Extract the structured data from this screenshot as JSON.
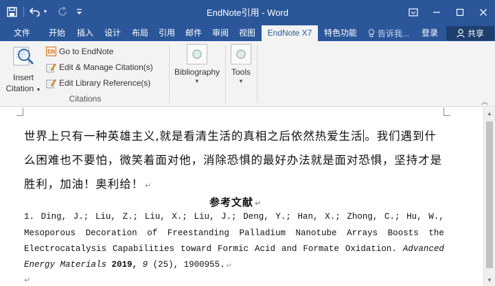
{
  "app": {
    "title": "EndNote引用 - Word"
  },
  "tabs": [
    {
      "label": "文件",
      "active": false
    },
    {
      "label": "开始",
      "active": false
    },
    {
      "label": "插入",
      "active": false
    },
    {
      "label": "设计",
      "active": false
    },
    {
      "label": "布局",
      "active": false
    },
    {
      "label": "引用",
      "active": false
    },
    {
      "label": "邮件",
      "active": false
    },
    {
      "label": "审阅",
      "active": false
    },
    {
      "label": "视图",
      "active": false
    },
    {
      "label": "EndNote X7",
      "active": true
    },
    {
      "label": "特色功能",
      "active": false
    }
  ],
  "tell_me": "告诉我...",
  "login": "登录",
  "share": "共享",
  "ribbon": {
    "insert_citation": {
      "line1": "Insert",
      "line2": "Citation"
    },
    "commands": [
      {
        "label": "Go to EndNote",
        "icon": "endnote-icon"
      },
      {
        "label": "Edit & Manage Citation(s)",
        "icon": "edit-citation-icon"
      },
      {
        "label": "Edit Library Reference(s)",
        "icon": "edit-reference-icon"
      }
    ],
    "group_label": "Citations",
    "bibliography": "Bibliography",
    "tools": "Tools"
  },
  "document": {
    "para": {
      "line1_a": "世界上只有一种英雄主义,就是看清生活的真相之后依然热爱生活",
      "line1_b": "。我们遇到什",
      "line2": "么困难也不要怕，微笑着面对他，消除恐惧的最好办法就是面对恐惧，坚持才是",
      "line3": "胜利，加油！奥利给！"
    },
    "heading": "参考文献",
    "reference": {
      "line1": [
        "1.",
        "Ding,",
        "J.;",
        "Liu,",
        "Z.;",
        "Liu,",
        "X.;",
        "Liu,",
        "J.;",
        "Deng,",
        "Y.;",
        "Han,",
        "X.;",
        "Zhong,",
        "C.;",
        "Hu,",
        "W.,"
      ],
      "line2": [
        "Mesoporous",
        "Decoration",
        "of",
        "Freestanding",
        "Palladium",
        "Nanotube",
        "Arrays",
        "Boosts",
        "the"
      ],
      "line3": [
        "Electrocatalysis",
        "Capabilities",
        "toward",
        "Formic",
        "Acid",
        "and",
        "Formate",
        "Oxidation.",
        "Advanced"
      ],
      "line4_journal": "Energy Materials",
      "line4_year": "2019,",
      "line4_volume": "9",
      "line4_rest": "(25), 1900955."
    },
    "paragraph_mark": "↵"
  },
  "colors": {
    "word_blue": "#2b579a",
    "ribbon_bg": "#f3f3f3"
  }
}
